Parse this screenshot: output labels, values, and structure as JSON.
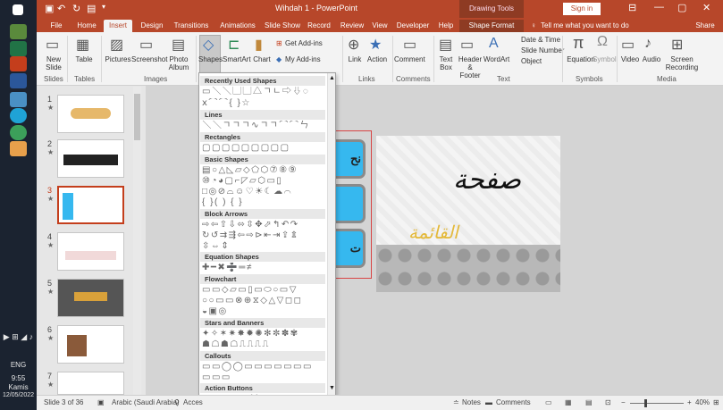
{
  "taskbar": {
    "icons": [
      "windows-icon",
      "taskview-icon",
      "excel-icon",
      "powerpoint-icon",
      "word-icon",
      "photos-icon",
      "edge-icon",
      "chrome-icon",
      "paint-icon"
    ],
    "tray": {
      "lang": "ENG",
      "time": "9:55",
      "day": "Kamis",
      "date": "12/05/2022"
    }
  },
  "titlebar": {
    "title": "Wihdah 1 - PowerPoint",
    "context_group": "Drawing Tools",
    "signin_label": "Sign in",
    "controls": [
      "restore-ribbon",
      "minimize",
      "maximize",
      "close"
    ]
  },
  "tabs": {
    "items": [
      "File",
      "Home",
      "Insert",
      "Design",
      "Transitions",
      "Animations",
      "Slide Show",
      "Record",
      "Review",
      "View",
      "Developer",
      "Help",
      "Shape Format"
    ],
    "active": "Insert",
    "tell_me": "Tell me what you want to do",
    "share": "Share"
  },
  "ribbon": {
    "groups": {
      "slides": {
        "label": "Slides",
        "new_slide": "New Slide"
      },
      "tables": {
        "label": "Tables",
        "table": "Table"
      },
      "images": {
        "label": "Images",
        "pictures": "Pictures",
        "screenshot": "Screenshot",
        "photo_album": "Photo Album"
      },
      "illustrations": {
        "shapes": "Shapes",
        "smartart": "SmartArt",
        "chart": "Chart"
      },
      "addins": {
        "get": "Get Add-ins",
        "my": "My Add-ins"
      },
      "links": {
        "label": "Links",
        "link": "Link",
        "action": "Action"
      },
      "comments": {
        "label": "Comments",
        "comment": "Comment"
      },
      "text": {
        "label": "Text",
        "textbox": "Text Box",
        "header_footer": "Header & Footer",
        "wordart": "WordArt",
        "date_time": "Date & Time",
        "slide_number": "Slide Number",
        "object": "Object"
      },
      "symbols": {
        "label": "Symbols",
        "equation": "Equation",
        "symbol": "Symbol"
      },
      "media": {
        "label": "Media",
        "video": "Video",
        "audio": "Audio",
        "screen_recording": "Screen Recording"
      }
    }
  },
  "gallery": {
    "sections": [
      {
        "title": "Recently Used Shapes",
        "rows": [
          "▭╲╲▢▢△ㄱㄴ⇨⇩◌",
          "ⅹ⌒⌒{ }☆"
        ]
      },
      {
        "title": "Lines",
        "rows": [
          "╲╲ㄱㄱㄱ∿ㄱㄱ⌒⌒ㄣ"
        ]
      },
      {
        "title": "Rectangles",
        "rows": [
          "▢▢▢▢▢▢▢▢▢"
        ]
      },
      {
        "title": "Basic Shapes",
        "rows": [
          "▤○△◺▱◇⬠⬡⑦⑧⑨",
          "⑩◔◕▢⌐◸▱⬡▭▯",
          "□◎⊘⌓☺♡☀☾☁⌒",
          "{ }( ) { }"
        ]
      },
      {
        "title": "Block Arrows",
        "rows": [
          "⇨⇦⇧⇩⬄⇳✥⬀↰↶↷",
          "↻↺⇉⇶⇦⇨⊳⇤⇥⇪⇭",
          "⇳⇔⇕"
        ]
      },
      {
        "title": "Equation Shapes",
        "rows": [
          "✚━✖➗═≠"
        ]
      },
      {
        "title": "Flowchart",
        "rows": [
          "▭▭◇▱▭▯▭⬭○▭▽",
          "○○▭▭⊗⊕⧖◇△▽◻◻",
          "◒▣◎"
        ]
      },
      {
        "title": "Stars and Banners",
        "rows": [
          "✦✧✶✷✸✹✺✻✼✽✾",
          "☗☖☗☖⎍⎍⎍⎍"
        ]
      },
      {
        "title": "Callouts",
        "rows": [
          "▭▭◯◯▭▭▭▭▭▭▭",
          "▭▭▭"
        ]
      },
      {
        "title": "Action Buttons",
        "rows": [
          "◁▷◁◁▷⌂ⓘ↩◫▭?"
        ]
      }
    ]
  },
  "thumbnails": {
    "numbers": [
      "1",
      "2",
      "3",
      "4",
      "5",
      "6",
      "7"
    ],
    "selected": "3"
  },
  "slide": {
    "title_text": "صفحة",
    "subtitle_text": "القائمة",
    "buttons": [
      "نح",
      "",
      "ت"
    ]
  },
  "statusbar": {
    "slide_count": "Slide 3 of 36",
    "language": "Arabic (Saudi Arabia)",
    "accessibility": "Acces",
    "notes": "Notes",
    "comments": "Comments",
    "zoom": "40%"
  },
  "colors": {
    "accent": "#b7472a",
    "selection": "#c43e1c",
    "slide_button": "#36b8ef",
    "frame": "#d84545"
  }
}
